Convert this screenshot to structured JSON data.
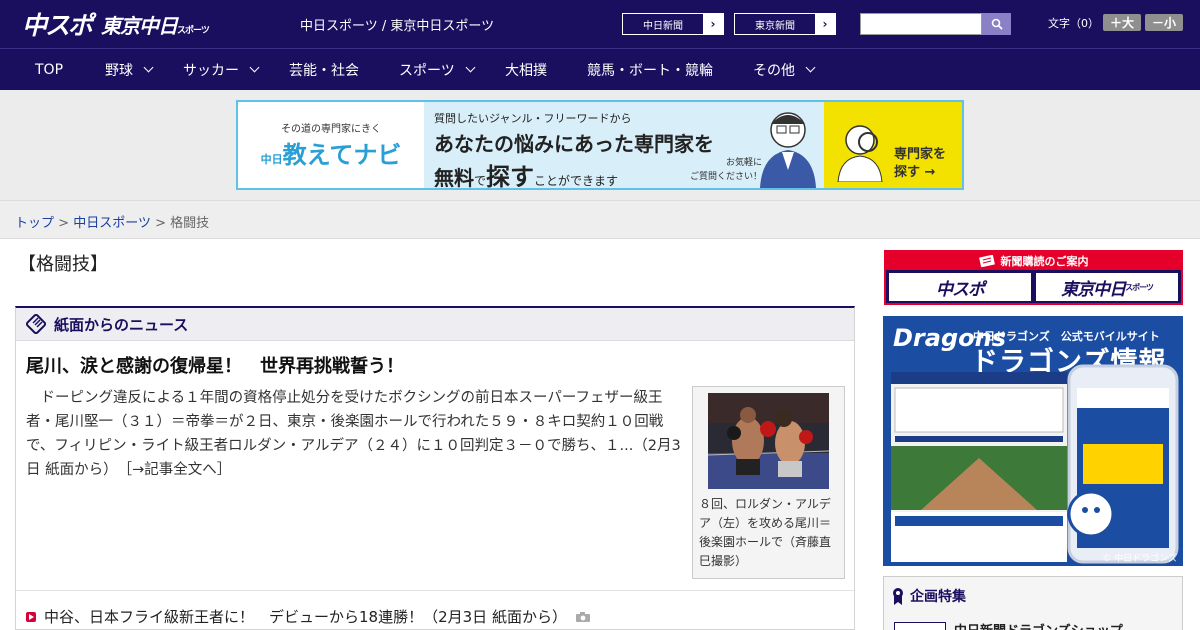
{
  "header": {
    "logo_chuspo": "中スポ",
    "logo_tokyo": "東京中日",
    "logo_tokyo_suffix": "スポーツ",
    "site_names": "中日スポーツ / 東京中日スポーツ",
    "chunichi_button": "中日新聞",
    "tokyo_button": "東京新聞",
    "search_placeholder": "",
    "fontsize_label": "文字（0）",
    "font_larger": "＋大",
    "font_smaller": "－小"
  },
  "nav": [
    {
      "label": "TOP",
      "has_menu": false
    },
    {
      "label": "野球",
      "has_menu": true
    },
    {
      "label": "サッカー",
      "has_menu": true
    },
    {
      "label": "芸能・社会",
      "has_menu": false
    },
    {
      "label": "スポーツ",
      "has_menu": true
    },
    {
      "label": "大相撲",
      "has_menu": false
    },
    {
      "label": "競馬・ボート・競輪",
      "has_menu": false
    },
    {
      "label": "その他",
      "has_menu": true
    }
  ],
  "banner": {
    "tagline": "その道の専門家にきく",
    "brand": "教えてナビ",
    "brand_prefix": "中日",
    "question": "質問したいジャンル・フリーワードから",
    "line1": "あなたの悩みにあった専門家を",
    "line2_a": "無料",
    "line2_b": "で",
    "line2_c": "探す",
    "line2_d": "ことができます",
    "note1": "お気軽に",
    "note2": "ご質問ください！",
    "cta1": "専門家を",
    "cta2": "探す →"
  },
  "breadcrumb": {
    "top": "トップ",
    "sep": ">",
    "section": "中日スポーツ",
    "current": "格闘技"
  },
  "page_title": "【格闘技】",
  "news": {
    "section_title": "紙面からのニュース",
    "headline": "尾川、涙と感謝の復帰星！　世界再挑戦誓う！",
    "lead": "　ドーピング違反による１年間の資格停止処分を受けたボクシングの前日本スーパーフェザー級王者・尾川堅一（３１）＝帝拳＝が２日、東京・後楽園ホールで行われた５９・８キロ契約１０回戦で、フィリピン・ライト級王者ロルダン・アルデア（２４）に１０回判定３－０で勝ち、１...（2月3日 紙面から）",
    "more_link": "［→記事全文へ］",
    "photo_caption": "８回、ロルダン・アルデア（左）を攻める尾川＝後楽園ホールで（斉藤直巳撮影）",
    "sub_items": [
      {
        "text": "中谷、日本フライ級新王者に！　デビューから18連勝！（2月3日 紙面から）",
        "has_photo": true
      }
    ]
  },
  "sidebar": {
    "subscription_title": "新聞購読のご案内",
    "sub_chuspo": "中スポ",
    "sub_tokyo": "東京中日",
    "sub_tokyo_suffix": "スポーツ",
    "dragons_brand": "Dragons",
    "dragons_sub": "中日ドラゴンズ　公式モバイルサイト",
    "dragons_title": "ドラゴンズ情報",
    "dragons_copy": "© 中日ドラゴンズ",
    "feature_title": "企画特集",
    "feature_item": "中日新聞ドラゴンズショップ"
  },
  "colors": {
    "header_bg": "#1a0f5e",
    "accent_red": "#e4002b",
    "link": "#1a3fa0"
  }
}
